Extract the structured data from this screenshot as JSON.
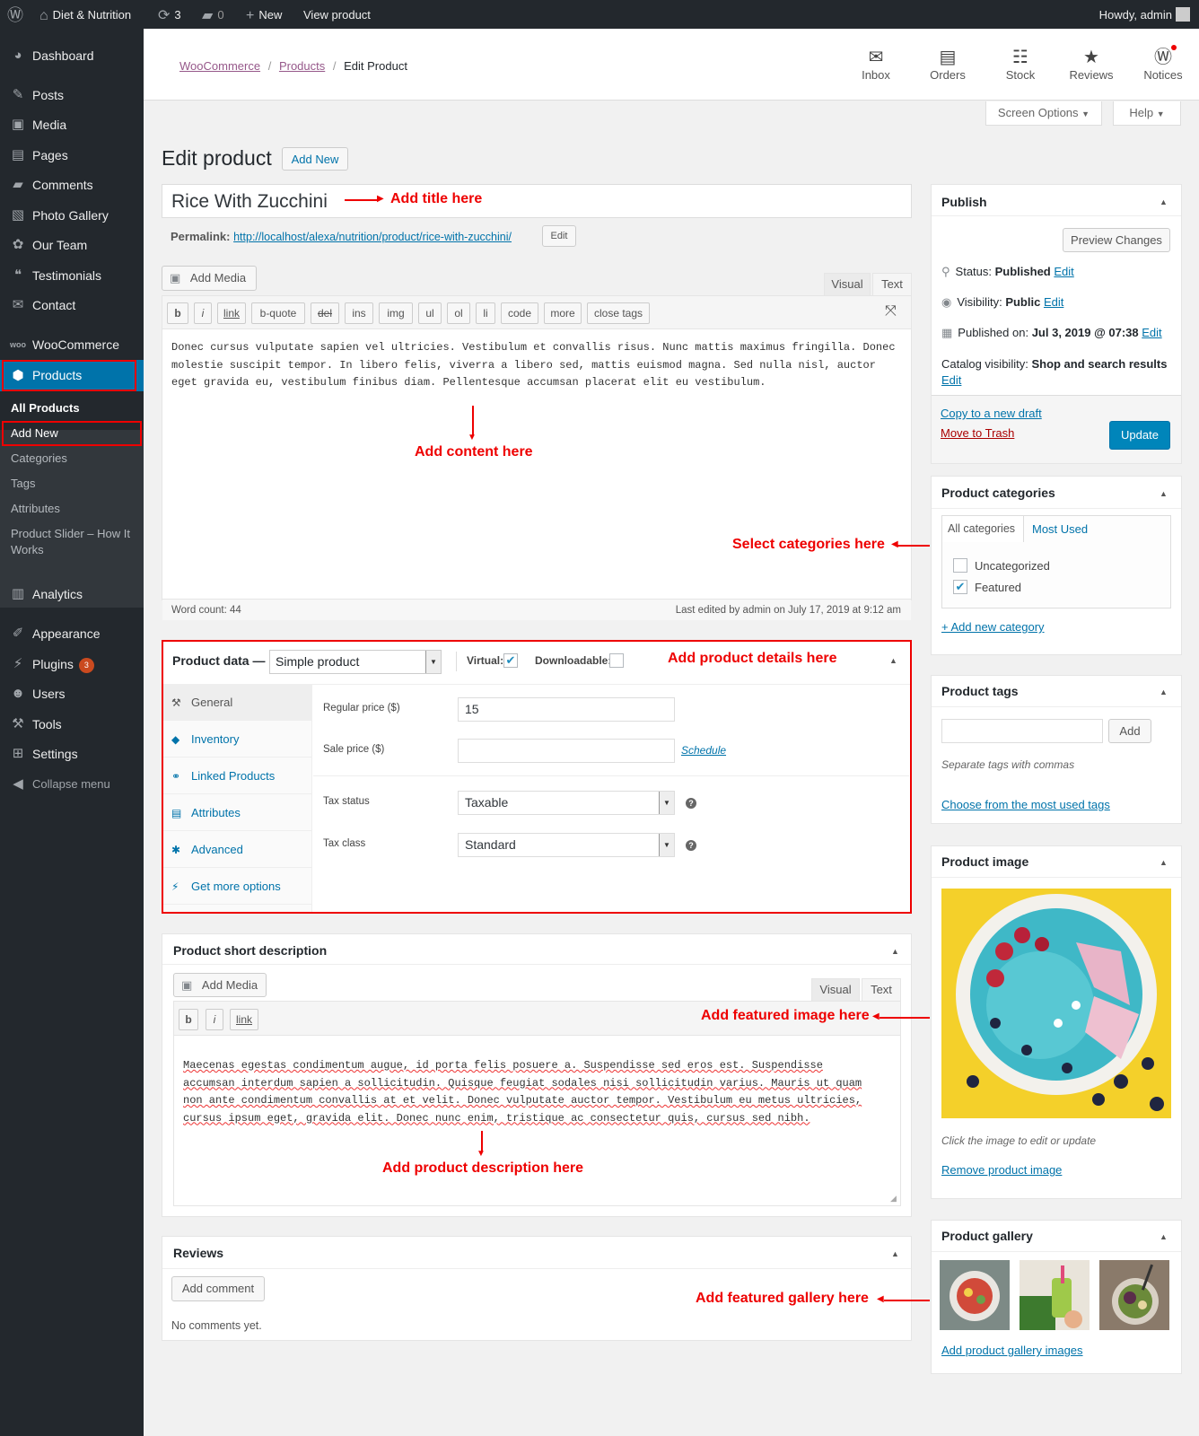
{
  "adminbar": {
    "site": "Diet & Nutrition",
    "updates": "3",
    "comments": "0",
    "new": "New",
    "view": "View product",
    "howdy": "Howdy, admin"
  },
  "sidebar": {
    "items": [
      {
        "label": "Dashboard",
        "icon": "dashboard-icon"
      },
      {
        "label": "Posts",
        "icon": "pin-icon"
      },
      {
        "label": "Media",
        "icon": "media-icon"
      },
      {
        "label": "Pages",
        "icon": "page-icon"
      },
      {
        "label": "Comments",
        "icon": "comment-icon"
      },
      {
        "label": "Photo Gallery",
        "icon": "gallery-icon"
      },
      {
        "label": "Our Team",
        "icon": "team-icon"
      },
      {
        "label": "Testimonials",
        "icon": "quote-icon"
      },
      {
        "label": "Contact",
        "icon": "mail-icon"
      },
      {
        "label": "WooCommerce",
        "icon": "woo-icon"
      },
      {
        "label": "Products",
        "icon": "box-icon"
      },
      {
        "label": "Analytics",
        "icon": "chart-icon"
      },
      {
        "label": "Appearance",
        "icon": "brush-icon"
      },
      {
        "label": "Plugins",
        "icon": "plugin-icon",
        "badge": "3"
      },
      {
        "label": "Users",
        "icon": "user-icon"
      },
      {
        "label": "Tools",
        "icon": "wrench-icon"
      },
      {
        "label": "Settings",
        "icon": "settings-icon"
      },
      {
        "label": "Collapse menu",
        "icon": "collapse-icon"
      }
    ],
    "submenu": [
      "All Products",
      "Add New",
      "Categories",
      "Tags",
      "Attributes",
      "Product Slider – How It",
      "Works"
    ]
  },
  "header": {
    "crumb1": "WooCommerce",
    "crumb2": "Products",
    "crumb3": "Edit Product",
    "actions": [
      "Inbox",
      "Orders",
      "Stock",
      "Reviews",
      "Notices"
    ],
    "screen_options": "Screen Options",
    "help": "Help"
  },
  "editor": {
    "heading": "Edit product",
    "add_new": "Add New",
    "title": "Rice With Zucchini",
    "permalink_label": "Permalink:",
    "permalink_url": "http://localhost/alexa/nutrition/product/rice-with-zucchini/",
    "edit": "Edit",
    "add_media": "Add Media",
    "tab_visual": "Visual",
    "tab_text": "Text",
    "quicktags": [
      "b",
      "i",
      "link",
      "b-quote",
      "del",
      "ins",
      "img",
      "ul",
      "ol",
      "li",
      "code",
      "more",
      "close tags"
    ],
    "content": "Donec cursus vulputate sapien vel ultricies. Vestibulum et convallis risus. Nunc mattis maximus fringilla. Donec molestie suscipit tempor. In libero felis, viverra a libero sed, mattis euismod magna. Sed nulla nisl, auctor eget gravida eu, vestibulum finibus diam. Pellentesque accumsan placerat elit eu vestibulum.",
    "word_count": "Word count: 44",
    "last_edited": "Last edited by admin on July 17, 2019 at 9:12 am"
  },
  "product_data": {
    "title": "Product data —",
    "type": "Simple product",
    "virtual": "Virtual:",
    "downloadable": "Downloadable:",
    "tabs": [
      "General",
      "Inventory",
      "Linked Products",
      "Attributes",
      "Advanced",
      "Get more options"
    ],
    "regular_price_label": "Regular price ($)",
    "regular_price": "15",
    "sale_price_label": "Sale price ($)",
    "schedule": "Schedule",
    "tax_status_label": "Tax status",
    "tax_status": "Taxable",
    "tax_class_label": "Tax class",
    "tax_class": "Standard"
  },
  "short_desc": {
    "title": "Product short description",
    "add_media": "Add Media",
    "tab_visual": "Visual",
    "tab_text": "Text",
    "quicktags": [
      "b",
      "i",
      "link"
    ],
    "content": "Maecenas egestas condimentum augue, id porta felis posuere a. Suspendisse sed eros est. Suspendisse accumsan interdum sapien a sollicitudin. Quisque feugiat sodales nisi sollicitudin varius. Mauris ut quam non ante condimentum convallis at et velit. Donec vulputate auctor tempor. Vestibulum eu metus ultricies, cursus ipsum eget, gravida elit. Donec nunc enim, tristique ac consectetur quis, cursus sed nibh."
  },
  "reviews": {
    "title": "Reviews",
    "add_comment": "Add comment",
    "empty": "No comments yet."
  },
  "publish": {
    "title": "Publish",
    "preview": "Preview Changes",
    "status_label": "Status:",
    "status": "Published",
    "visibility_label": "Visibility:",
    "visibility": "Public",
    "published_label": "Published on:",
    "published": "Jul 3, 2019 @ 07:38",
    "catalog_label": "Catalog visibility:",
    "catalog": "Shop and search results",
    "edit": "Edit",
    "copy": "Copy to a new draft",
    "trash": "Move to Trash",
    "update": "Update"
  },
  "categories": {
    "title": "Product categories",
    "tab_all": "All categories",
    "tab_most": "Most Used",
    "items": [
      {
        "label": "Uncategorized",
        "checked": false
      },
      {
        "label": "Featured",
        "checked": true
      }
    ],
    "add": "+ Add new category"
  },
  "tags": {
    "title": "Product tags",
    "add": "Add",
    "hint": "Separate tags with commas",
    "choose": "Choose from the most used tags"
  },
  "image": {
    "title": "Product image",
    "hint": "Click the image to edit or update",
    "remove": "Remove product image"
  },
  "gallery": {
    "title": "Product gallery",
    "add": "Add product gallery images"
  },
  "annotations": {
    "title": "Add title here",
    "content": "Add content here",
    "categories": "Select categories here",
    "details": "Add product details here",
    "featured_image": "Add featured image here",
    "description": "Add product description here",
    "gallery": "Add featured gallery here"
  }
}
